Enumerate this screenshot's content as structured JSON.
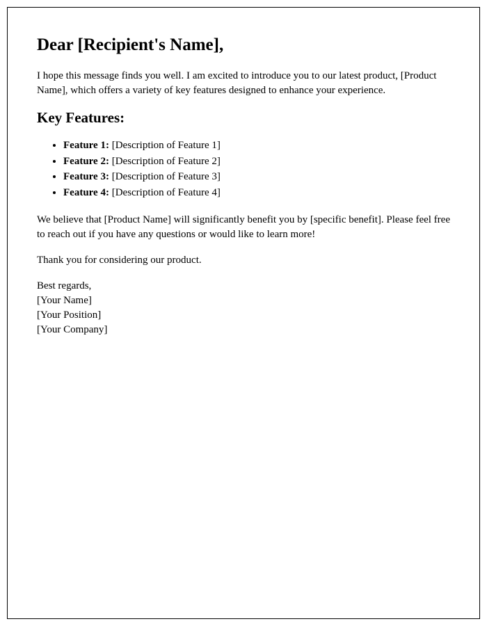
{
  "salutation": "Dear [Recipient's Name],",
  "intro": "I hope this message finds you well. I am excited to introduce you to our latest product, [Product Name], which offers a variety of key features designed to enhance your experience.",
  "features_heading": "Key Features:",
  "features": [
    {
      "label": "Feature 1:",
      "description": " [Description of Feature 1]"
    },
    {
      "label": "Feature 2:",
      "description": " [Description of Feature 2]"
    },
    {
      "label": "Feature 3:",
      "description": " [Description of Feature 3]"
    },
    {
      "label": "Feature 4:",
      "description": " [Description of Feature 4]"
    }
  ],
  "benefit_paragraph": "We believe that [Product Name] will significantly benefit you by [specific benefit]. Please feel free to reach out if you have any questions or would like to learn more!",
  "thank_you": "Thank you for considering our product.",
  "closing": {
    "regards": "Best regards,",
    "name": "[Your Name]",
    "position": "[Your Position]",
    "company": "[Your Company]"
  }
}
